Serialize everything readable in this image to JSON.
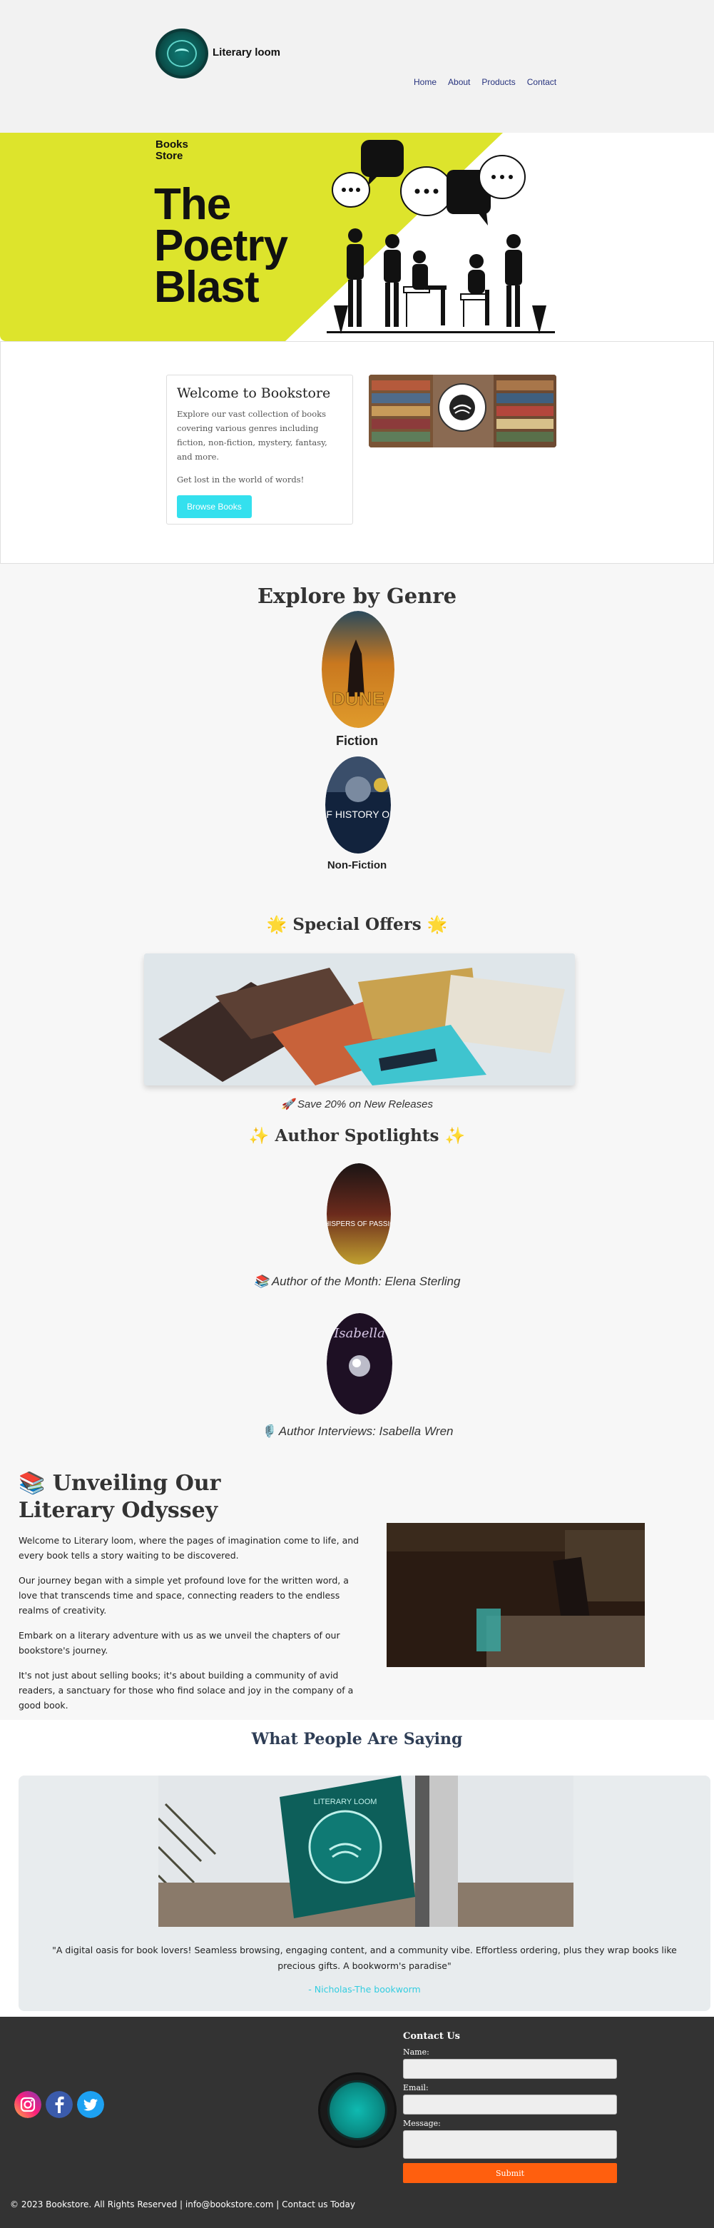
{
  "header": {
    "brand": "Literary loom",
    "nav": [
      "Home",
      "About",
      "Products",
      "Contact"
    ]
  },
  "hero": {
    "small_line1": "Books",
    "small_line2": "Store",
    "title_line1": "The",
    "title_line2": "Poetry",
    "title_line3": "Blast",
    "accent_color": "#dde42c"
  },
  "welcome": {
    "title": "Welcome to Bookstore",
    "body": "Explore our vast collection of books covering various genres including fiction, non-fiction, mystery, fantasy, and more.",
    "tagline": "Get lost in the world of words!",
    "button": "Browse Books",
    "button_color": "#34e0ee"
  },
  "genres": {
    "title": "Explore by Genre",
    "items": [
      {
        "label": "Fiction",
        "cover_text": "DUNE"
      },
      {
        "label": "Non-Fiction",
        "cover_text": "A BRIEF HISTORY OF TIME"
      }
    ]
  },
  "offers": {
    "title": "🌟 Special Offers 🌟",
    "caption": "🚀 Save 20% on New Releases"
  },
  "spotlights": {
    "title": "✨ Author Spotlights ✨",
    "items": [
      {
        "caption": "📚 Author of the Month: Elena Sterling",
        "cover_text": "WHISPERS OF PASSION"
      },
      {
        "caption": "🎙️ Author Interviews: Isabella Wren",
        "cover_text": "Isabella"
      }
    ]
  },
  "about": {
    "title": "📚 Unveiling Our Literary Odyssey",
    "paragraphs": [
      "Welcome to Literary loom, where the pages of imagination come to life, and every book tells a story waiting to be discovered.",
      "Our journey began with a simple yet profound love for the written word, a love that transcends time and space, connecting readers to the endless realms of creativity.",
      "Embark on a literary adventure with us as we unveil the chapters of our bookstore's journey.",
      "It's not just about selling books; it's about building a community of avid readers, a sanctuary for those who find solace and joy in the company of a good book."
    ]
  },
  "testimonials": {
    "title": "What People Are Saying",
    "quote": "\"A digital oasis for book lovers! Seamless browsing, engaging content, and a community vibe. Effortless ordering, plus they wrap books like precious gifts. A bookworm's paradise\"",
    "author": "- Nicholas-The bookworm",
    "logo_text": "LITERARY LOOM"
  },
  "footer": {
    "contact_title": "Contact Us",
    "name_label": "Name:",
    "email_label": "Email:",
    "message_label": "Message:",
    "submit": "Submit",
    "copyright": "© 2023 Bookstore. All Rights Reserved | info@bookstore.com | Contact us Today",
    "socials": [
      "instagram-icon",
      "facebook-icon",
      "twitter-icon"
    ],
    "submit_color": "#ff5f0e"
  }
}
